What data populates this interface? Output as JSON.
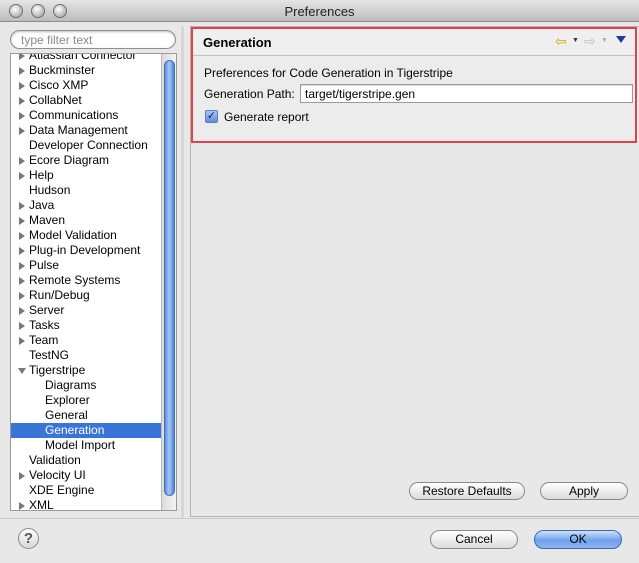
{
  "window": {
    "title": "Preferences"
  },
  "filter": {
    "placeholder": "type filter text"
  },
  "tree": {
    "items": [
      {
        "label": "Atlassian Connector",
        "level": 0,
        "expandable": true
      },
      {
        "label": "Buckminster",
        "level": 0,
        "expandable": true
      },
      {
        "label": "Cisco XMP",
        "level": 0,
        "expandable": true
      },
      {
        "label": "CollabNet",
        "level": 0,
        "expandable": true
      },
      {
        "label": "Communications",
        "level": 0,
        "expandable": true
      },
      {
        "label": "Data Management",
        "level": 0,
        "expandable": true
      },
      {
        "label": "Developer Connection",
        "level": 0,
        "expandable": false
      },
      {
        "label": "Ecore Diagram",
        "level": 0,
        "expandable": true
      },
      {
        "label": "Help",
        "level": 0,
        "expandable": true
      },
      {
        "label": "Hudson",
        "level": 0,
        "expandable": false
      },
      {
        "label": "Java",
        "level": 0,
        "expandable": true
      },
      {
        "label": "Maven",
        "level": 0,
        "expandable": true
      },
      {
        "label": "Model Validation",
        "level": 0,
        "expandable": true
      },
      {
        "label": "Plug-in Development",
        "level": 0,
        "expandable": true
      },
      {
        "label": "Pulse",
        "level": 0,
        "expandable": true
      },
      {
        "label": "Remote Systems",
        "level": 0,
        "expandable": true
      },
      {
        "label": "Run/Debug",
        "level": 0,
        "expandable": true
      },
      {
        "label": "Server",
        "level": 0,
        "expandable": true
      },
      {
        "label": "Tasks",
        "level": 0,
        "expandable": true
      },
      {
        "label": "Team",
        "level": 0,
        "expandable": true
      },
      {
        "label": "TestNG",
        "level": 0,
        "expandable": false
      },
      {
        "label": "Tigerstripe",
        "level": 0,
        "expandable": true,
        "expanded": true
      },
      {
        "label": "Diagrams",
        "level": 1
      },
      {
        "label": "Explorer",
        "level": 1
      },
      {
        "label": "General",
        "level": 1
      },
      {
        "label": "Generation",
        "level": 1,
        "selected": true
      },
      {
        "label": "Model Import",
        "level": 1
      },
      {
        "label": "Validation",
        "level": 0,
        "expandable": false
      },
      {
        "label": "Velocity UI",
        "level": 0,
        "expandable": true
      },
      {
        "label": "XDE Engine",
        "level": 0,
        "expandable": false
      },
      {
        "label": "XML",
        "level": 0,
        "expandable": true
      }
    ]
  },
  "page": {
    "title": "Generation",
    "description": "Preferences for Code Generation in Tigerstripe",
    "generation_path_label": "Generation Path:",
    "generation_path_value": "target/tigerstripe.gen",
    "generate_report_label": "Generate report",
    "generate_report_checked": true,
    "restore_defaults_label": "Restore Defaults",
    "apply_label": "Apply"
  },
  "footer": {
    "help_glyph": "?",
    "cancel_label": "Cancel",
    "ok_label": "OK"
  },
  "colors": {
    "selection": "#3875d7",
    "highlight_border": "#e0424b",
    "default_button": "#6fa0ec"
  }
}
